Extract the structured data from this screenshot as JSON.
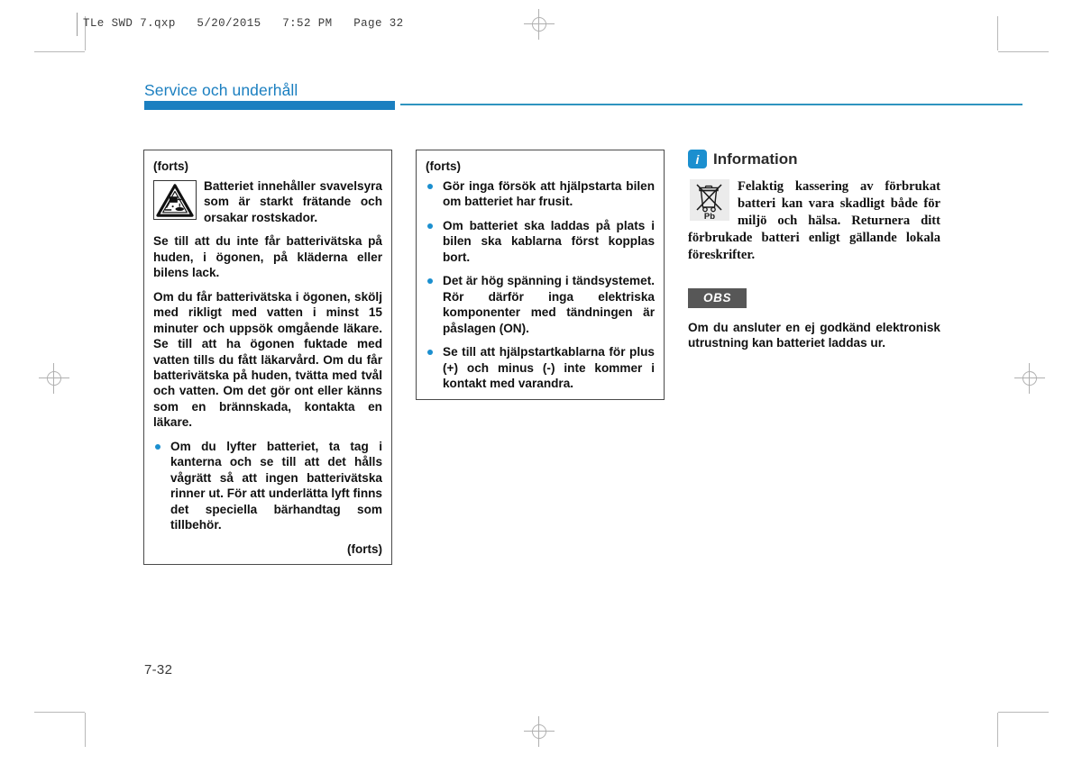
{
  "print_header": {
    "text": "TLe SWD 7.qxp   5/20/2015   7:52 PM   Page 32"
  },
  "section": {
    "title": "Service och underhåll",
    "accent_color": "#1b7fc0",
    "rule_color": "#2f94bf"
  },
  "column1": {
    "continued_label": "(forts)",
    "icon": "corrosive-hazard-icon",
    "icon_paragraph": "Batteriet innehåller svavelsyra som är starkt frätande och orsakar rostskador.",
    "paragraphs": [
      "Se till att du inte får batterivätska på huden, i ögonen, på kläderna eller bilens lack.",
      "Om du får batterivätska i ögonen, skölj med rikligt med vatten i minst 15 minuter och uppsök omgående läkare. Se till att ha ögonen fuktade med vatten tills du fått läkarvård. Om du får batterivätska på huden, tvätta med tvål och vatten. Om det gör ont eller känns som en brännskada, kontakta en läkare."
    ],
    "bullets": [
      "Om du lyfter batteriet, ta tag i kanterna och se till att det hålls vågrätt så att ingen batterivätska rinner ut. För att underlätta lyft finns det speciella bärhandtag som tillbehör."
    ],
    "continued_end_label": "(forts)",
    "bullet_color": "#1b8fcf"
  },
  "column2": {
    "continued_label": "(forts)",
    "bullets": [
      "Gör inga försök att hjälpstarta bilen om batteriet har frusit.",
      "Om batteriet ska laddas på plats i bilen ska kablarna först kopplas bort.",
      "Det är hög spänning i tändsystemet. Rör därför inga elektriska komponenter med tändningen är påslagen (ON).",
      "Se till att hjälpstartkablarna för plus (+) och minus (-) inte kommer i kontakt med varandra."
    ],
    "bullet_color": "#1b8fcf"
  },
  "column3": {
    "information": {
      "badge_glyph": "i",
      "title": "Information",
      "icon": "crossed-out-wheelie-bin-icon",
      "icon_label": "Pb",
      "body": "Felaktig kassering av förbrukat batteri kan vara skadligt både för miljö och hälsa. Returnera ditt förbrukade batteri enligt gällande lokala föreskrifter."
    },
    "notice": {
      "badge_label": "OBS",
      "badge_color": "#575757",
      "body": "Om du ansluter en ej godkänd elektronisk utrustning kan batteriet laddas ur."
    }
  },
  "footer": {
    "page_number": "7-32"
  }
}
